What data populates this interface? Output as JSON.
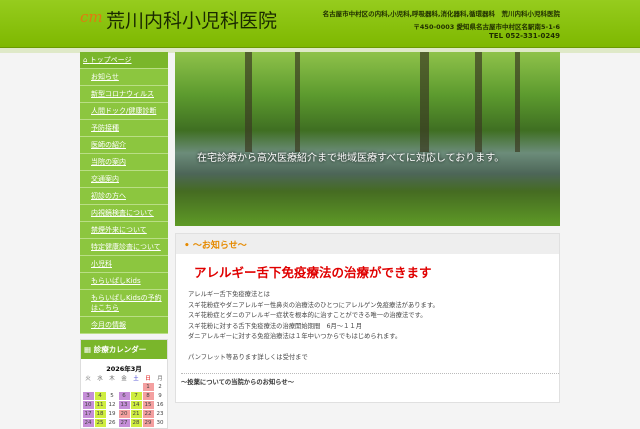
{
  "header": {
    "logo_mark": "cm",
    "title": "荒川内科小児科医院",
    "tagline": "名古屋市中村区の内科,小児科,呼吸器科,消化器科,循環器科　荒川内科小児科医院",
    "address": "〒450-0003 愛知県名古屋市中村区名駅南5-1-6",
    "tel": "TEL 052-331-0249"
  },
  "sidebar": {
    "items": [
      "トップページ",
      "お知らせ",
      "新型コロナウィルス",
      "人間ドック/健康診断",
      "予防接種",
      "医師の紹介",
      "当院の案内",
      "交通案内",
      "初診の方へ",
      "内視鏡検査について",
      "禁煙外来について",
      "特定健康診査について",
      "小児科",
      "もらいぱしKids",
      "もらいぱしKidsの予約はこちら",
      "今月の情報"
    ]
  },
  "calendar": {
    "heading": "診療カレンダー",
    "month": "2026年3月",
    "weekdays": [
      "火",
      "水",
      "木",
      "金",
      "土",
      "日",
      "月"
    ],
    "weeks": [
      [
        "",
        "",
        "",
        "",
        "",
        "1",
        "2"
      ],
      [
        "3",
        "4",
        "5",
        "6",
        "7",
        "8",
        "9"
      ],
      [
        "10",
        "11",
        "12",
        "13",
        "14",
        "15",
        "16"
      ],
      [
        "17",
        "18",
        "19",
        "20",
        "21",
        "22",
        "23"
      ],
      [
        "24",
        "25",
        "26",
        "27",
        "28",
        "29",
        "30"
      ]
    ]
  },
  "hero": {
    "caption": "在宅診療から高次医療紹介まで地域医療すべてに対応しております。"
  },
  "notice": {
    "heading": "〜お知らせ〜",
    "headline": "アレルギー舌下免疫療法の治療ができます",
    "lines": [
      "アレルギー舌下免疫療法とは",
      "スギ花粉症やダニアレルギー性鼻炎の治療法のひとつにアレルゲン免疫療法があります。",
      "スギ花粉症とダニのアレルギー症状を根本的に治すことができる唯一の治療法です。",
      "スギ花粉に対する舌下免疫療法の治療開始期間　6月〜１１月",
      "ダニアレルギーに対する免疫治療法は１年中いつからでもはじめられます。",
      "",
      "パンフレット等あります詳しくは受付まで"
    ],
    "section2": "〜投薬についての当院からのお知らせ〜"
  }
}
